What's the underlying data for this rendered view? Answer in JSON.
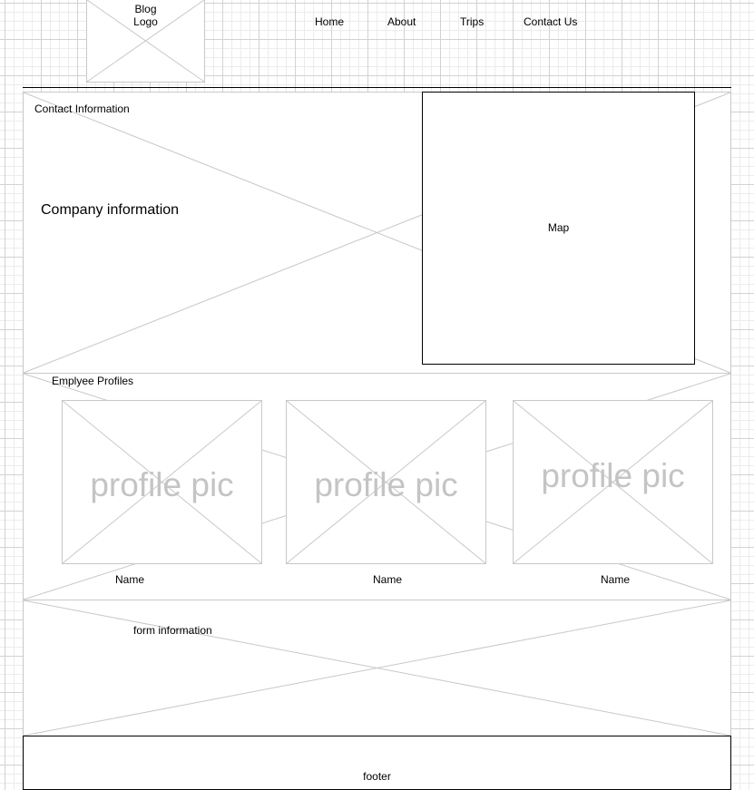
{
  "header": {
    "logo_line1": "Blog",
    "logo_line2": "Logo",
    "nav": [
      "Home",
      "About",
      "Trips",
      "Contact Us"
    ]
  },
  "contact_section": {
    "title": "Contact Information",
    "company_info": "Company information",
    "map_label": "Map"
  },
  "employees_section": {
    "title": "Emplyee Profiles",
    "profiles": [
      {
        "pic_label": "profile pic",
        "name": "Name"
      },
      {
        "pic_label": "profile pic",
        "name": "Name"
      },
      {
        "pic_label": "profile pic",
        "name": "Name"
      }
    ]
  },
  "form_section": {
    "title": "form information"
  },
  "footer": {
    "label": "footer"
  },
  "colors": {
    "placeholder_stroke": "#c8c8c8",
    "grid_minor": "#ececec",
    "grid_major": "#d2d2d2",
    "border_dark": "#000000"
  }
}
